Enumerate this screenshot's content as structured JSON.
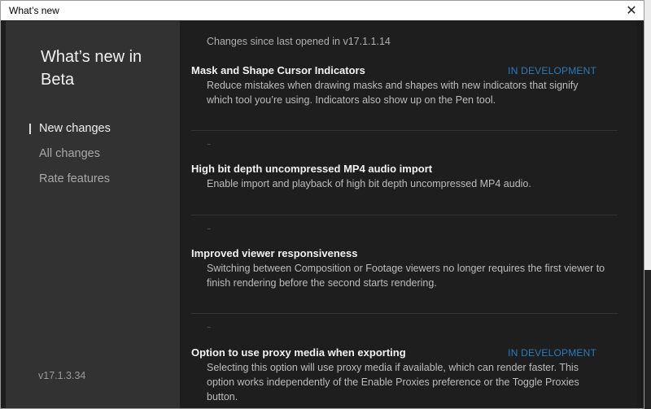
{
  "window": {
    "title": "What’s new",
    "close_glyph": "✕"
  },
  "sidebar": {
    "heading": "What’s new in Beta",
    "items": [
      {
        "label": "New changes",
        "active": true
      },
      {
        "label": "All changes",
        "active": false
      },
      {
        "label": "Rate features",
        "active": false
      }
    ],
    "version": "v17.1.3.34"
  },
  "content": {
    "since": "Changes since last opened in v17.1.1.14",
    "features": [
      {
        "title": "Mask and Shape Cursor Indicators",
        "badge": "IN DEVELOPMENT",
        "description": "Reduce mistakes when drawing masks and shapes with new indicators that signify which tool you’re using. Indicators also show up on the Pen tool."
      },
      {
        "title": "High bit depth uncompressed MP4 audio import",
        "badge": "",
        "description": "Enable import and playback of high bit depth uncompressed MP4 audio."
      },
      {
        "title": "Improved viewer responsiveness",
        "badge": "",
        "description": "Switching between Composition or Footage viewers no longer requires the first viewer to finish rendering before the second starts rendering."
      },
      {
        "title": "Option to use proxy media when exporting",
        "badge": "IN DEVELOPMENT",
        "description": "Selecting this option will use proxy media if available, which can render faster. This option works independently of the Enable Proxies preference or the Toggle Proxies button."
      }
    ]
  },
  "colors": {
    "sidebar_bg": "#323232",
    "content_bg": "#1e1e1e",
    "badge": "#2a7bbd"
  }
}
